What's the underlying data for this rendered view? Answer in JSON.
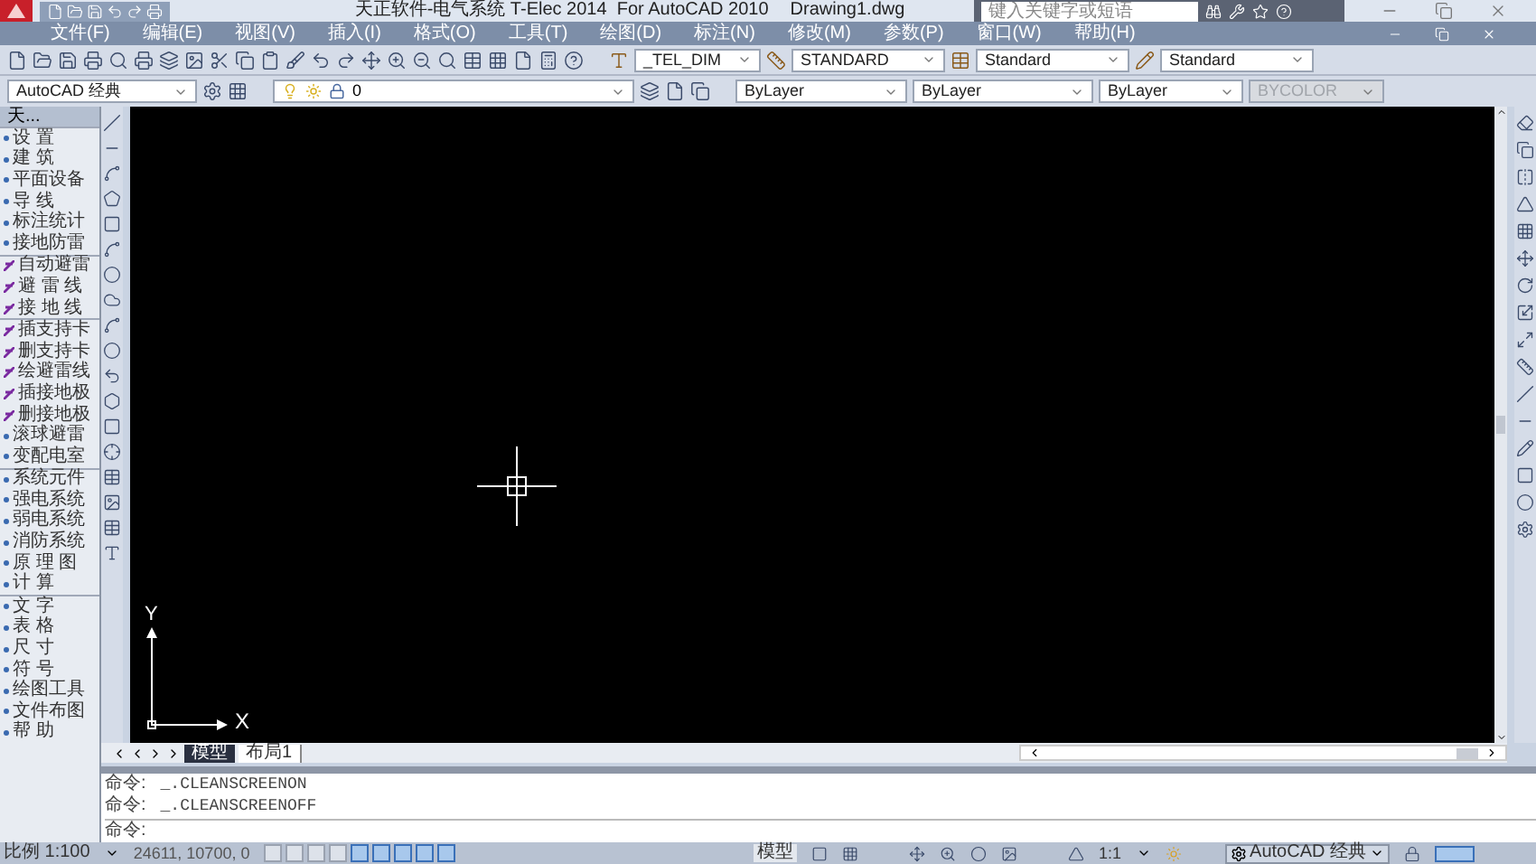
{
  "title_bar": {
    "title": "天正软件-电气系统 T-Elec 2014  For AutoCAD 2010",
    "file": "Drawing1.dwg",
    "search": {
      "placeholder": "键入关键字或短语"
    }
  },
  "menu": [
    "文件(F)",
    "编辑(E)",
    "视图(V)",
    "插入(I)",
    "格式(O)",
    "工具(T)",
    "绘图(D)",
    "标注(N)",
    "修改(M)",
    "参数(P)",
    "窗口(W)",
    "帮助(H)"
  ],
  "style_toolbar": {
    "combos": [
      "_TEL_DIM",
      "STANDARD",
      "Standard",
      "Standard"
    ]
  },
  "properties_toolbar": {
    "workspace": "AutoCAD 经典",
    "layer": "0",
    "color_control": "ByLayer",
    "linetype": "ByLayer",
    "lineweight": "ByLayer",
    "plot_style": {
      "value": "BYCOLOR",
      "disabled": true
    }
  },
  "sidebar": {
    "header": "天...",
    "groups": [
      [
        {
          "label": "设 置",
          "kind": "bullet"
        },
        {
          "label": "建 筑",
          "kind": "bullet"
        },
        {
          "label": "平面设备",
          "kind": "bullet"
        },
        {
          "label": "导 线",
          "kind": "bullet"
        },
        {
          "label": "标注统计",
          "kind": "bullet"
        },
        {
          "label": "接地防雷",
          "kind": "bullet"
        }
      ],
      [
        {
          "label": "自动避雷",
          "kind": "icon"
        },
        {
          "label": "避 雷 线",
          "kind": "icon"
        },
        {
          "label": "接 地 线",
          "kind": "icon"
        }
      ],
      [
        {
          "label": "插支持卡",
          "kind": "icon"
        },
        {
          "label": "删支持卡",
          "kind": "icon"
        },
        {
          "label": "绘避雷线",
          "kind": "icon"
        },
        {
          "label": "插接地极",
          "kind": "icon"
        },
        {
          "label": "删接地极",
          "kind": "icon"
        },
        {
          "label": "滚球避雷",
          "kind": "bullet"
        },
        {
          "label": "变配电室",
          "kind": "bullet"
        }
      ],
      [
        {
          "label": "系统元件",
          "kind": "bullet"
        },
        {
          "label": "强电系统",
          "kind": "bullet"
        },
        {
          "label": "弱电系统",
          "kind": "bullet"
        },
        {
          "label": "消防系统",
          "kind": "bullet"
        },
        {
          "label": "原 理 图",
          "kind": "bullet"
        },
        {
          "label": "计 算",
          "kind": "bullet"
        }
      ],
      [
        {
          "label": "文 字",
          "kind": "bullet"
        },
        {
          "label": "表 格",
          "kind": "bullet"
        },
        {
          "label": "尺 寸",
          "kind": "bullet"
        },
        {
          "label": "符 号",
          "kind": "bullet"
        },
        {
          "label": "绘图工具",
          "kind": "bullet"
        },
        {
          "label": "文件布图",
          "kind": "bullet"
        },
        {
          "label": "帮 助",
          "kind": "bullet"
        }
      ]
    ]
  },
  "canvas": {
    "axis_x": "X",
    "axis_y": "Y"
  },
  "tabs": [
    {
      "label": "模型",
      "selected": true
    },
    {
      "label": "布局1",
      "selected": false
    }
  ],
  "command": {
    "history": [
      {
        "prompt": "命令:",
        "text": "_.CLEANSCREENON"
      },
      {
        "prompt": "命令:",
        "text": "_.CLEANSCREENOFF"
      }
    ],
    "prompt": "命令:"
  },
  "status_bar": {
    "scale": "比例 1:100",
    "coords": "24611, 10700, 0",
    "toggles": [
      {
        "on": false
      },
      {
        "on": false
      },
      {
        "on": false
      },
      {
        "on": false
      },
      {
        "on": true
      },
      {
        "on": true
      },
      {
        "on": true
      },
      {
        "on": true
      },
      {
        "on": true
      }
    ],
    "model": "模型",
    "annotation_scale": "1:1",
    "workspace": "AutoCAD 经典",
    "clean_screen_on": true
  }
}
